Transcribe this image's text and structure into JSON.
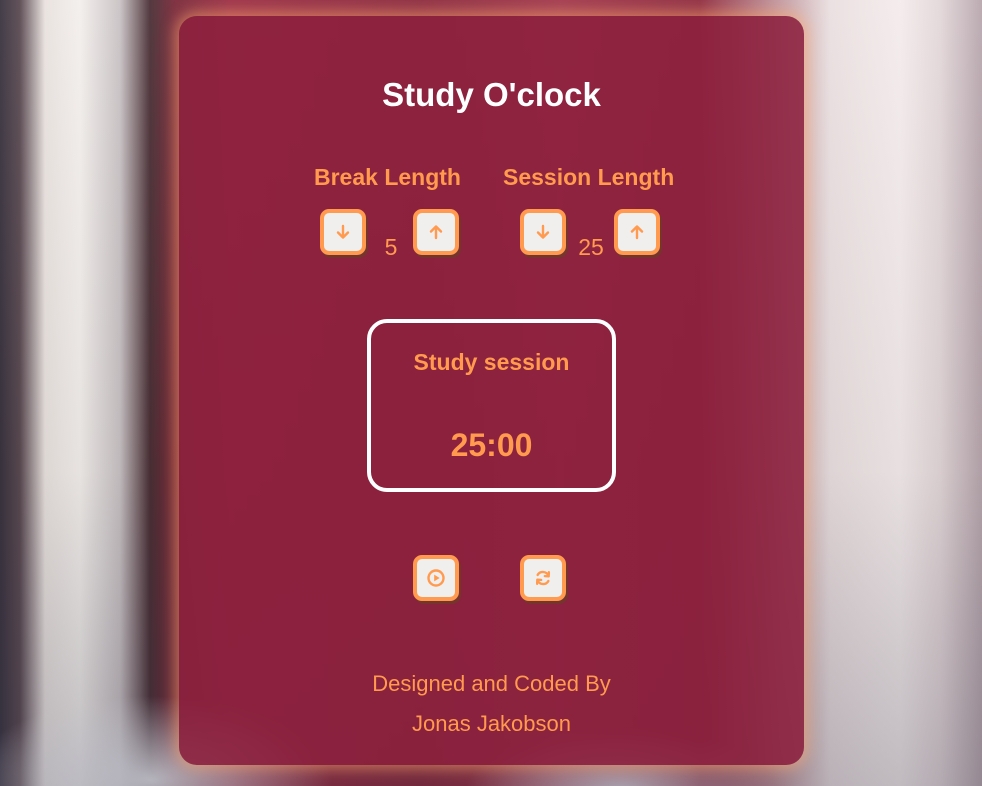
{
  "app": {
    "title": "Study O'clock"
  },
  "break": {
    "label": "Break Length",
    "value": "5",
    "decrement_icon": "arrow-down-icon",
    "increment_icon": "arrow-up-icon"
  },
  "session": {
    "label": "Session Length",
    "value": "25",
    "decrement_icon": "arrow-down-icon",
    "increment_icon": "arrow-up-icon"
  },
  "timer": {
    "label": "Study session",
    "time": "25:00"
  },
  "controls": {
    "play_icon": "play-icon",
    "reset_icon": "refresh-icon"
  },
  "footer": {
    "line1": "Designed and Coded By",
    "line2": "Jonas Jakobson"
  },
  "colors": {
    "accent": "#ff9a4f",
    "card": "#8c203e",
    "title": "#ffffff",
    "button_bg": "#f1eeee"
  }
}
